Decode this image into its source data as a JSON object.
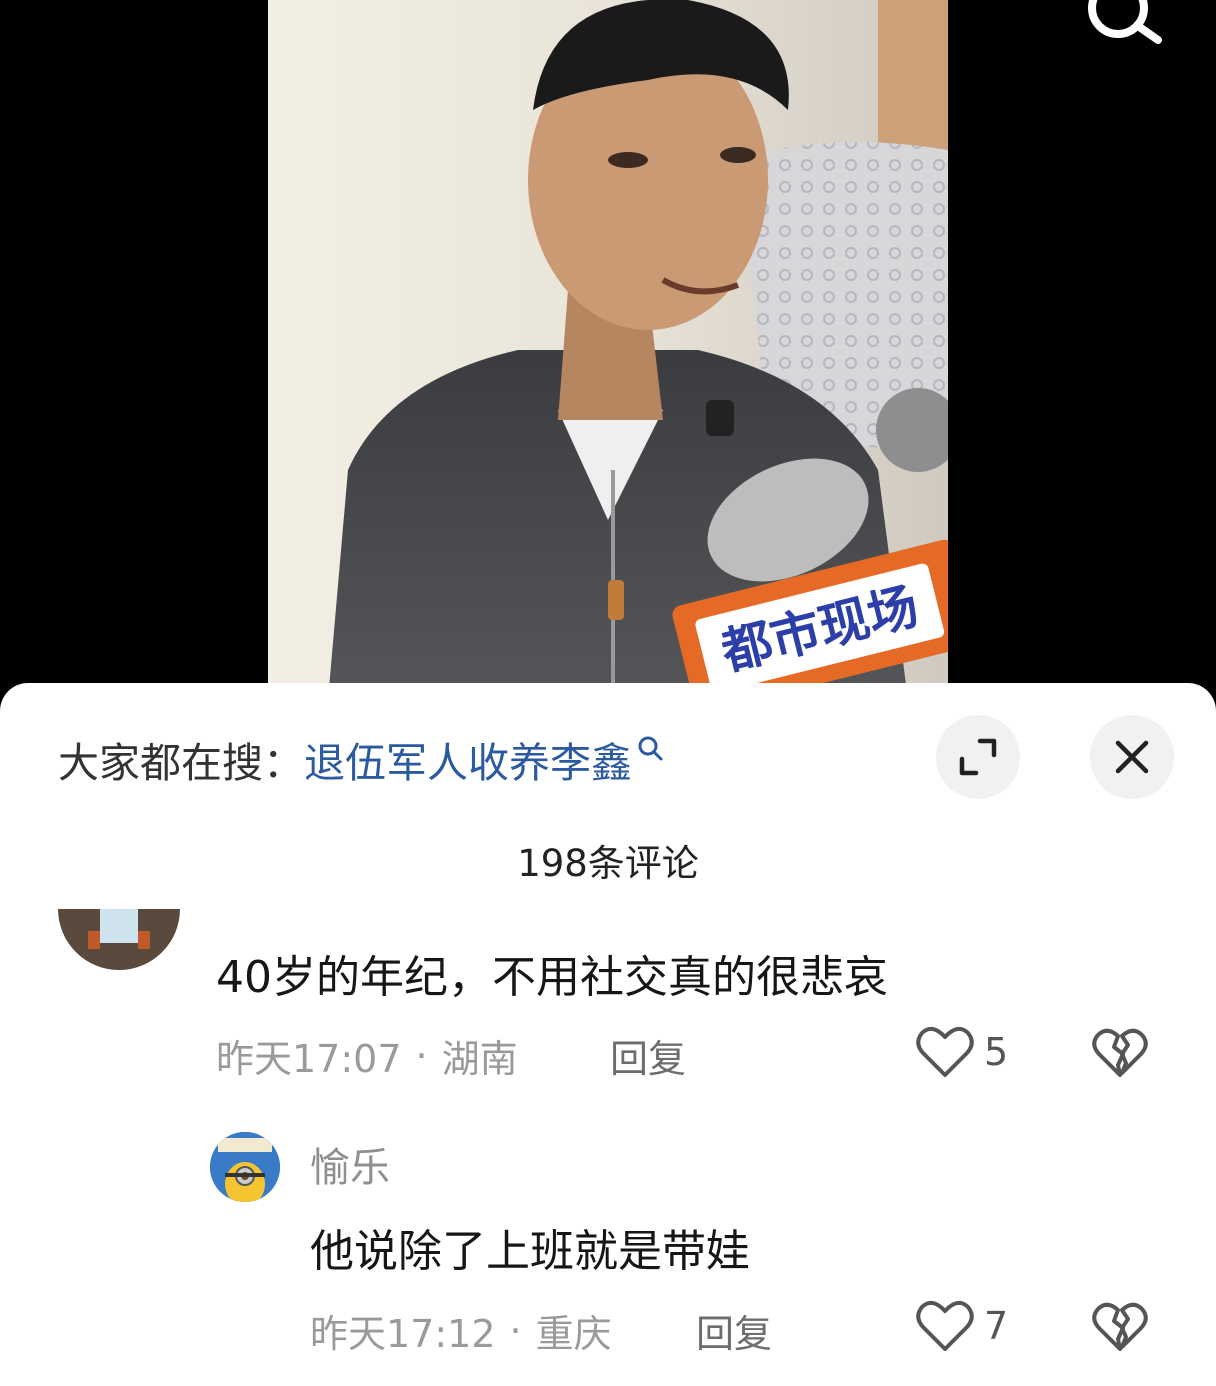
{
  "hot_search": {
    "prefix": "大家都在搜：",
    "term": "退伍军人收养李鑫"
  },
  "comments_header": {
    "count_label": "198条评论"
  },
  "comments": [
    {
      "text": "40岁的年纪，不用社交真的很悲哀",
      "time": "昨天17:07",
      "location": "湖南",
      "reply_label": "回复",
      "likes": "5"
    },
    {
      "user": "愉乐",
      "text": "他说除了上班就是带娃",
      "time": "昨天17:12",
      "location": "重庆",
      "reply_label": "回复",
      "likes": "7"
    }
  ],
  "video": {
    "mic_logo_text": "都市现场"
  },
  "icons": {
    "top_right": "search-icon",
    "hot_search_suffix": "search-icon",
    "expand": "expand-icon",
    "close": "close-icon",
    "like": "heart-outline-icon",
    "dislike": "broken-heart-icon"
  },
  "colors": {
    "hot_term": "#2b5aa0",
    "sheet_bg": "#ffffff",
    "meta_text": "#9a9a9a"
  },
  "separator": "·"
}
